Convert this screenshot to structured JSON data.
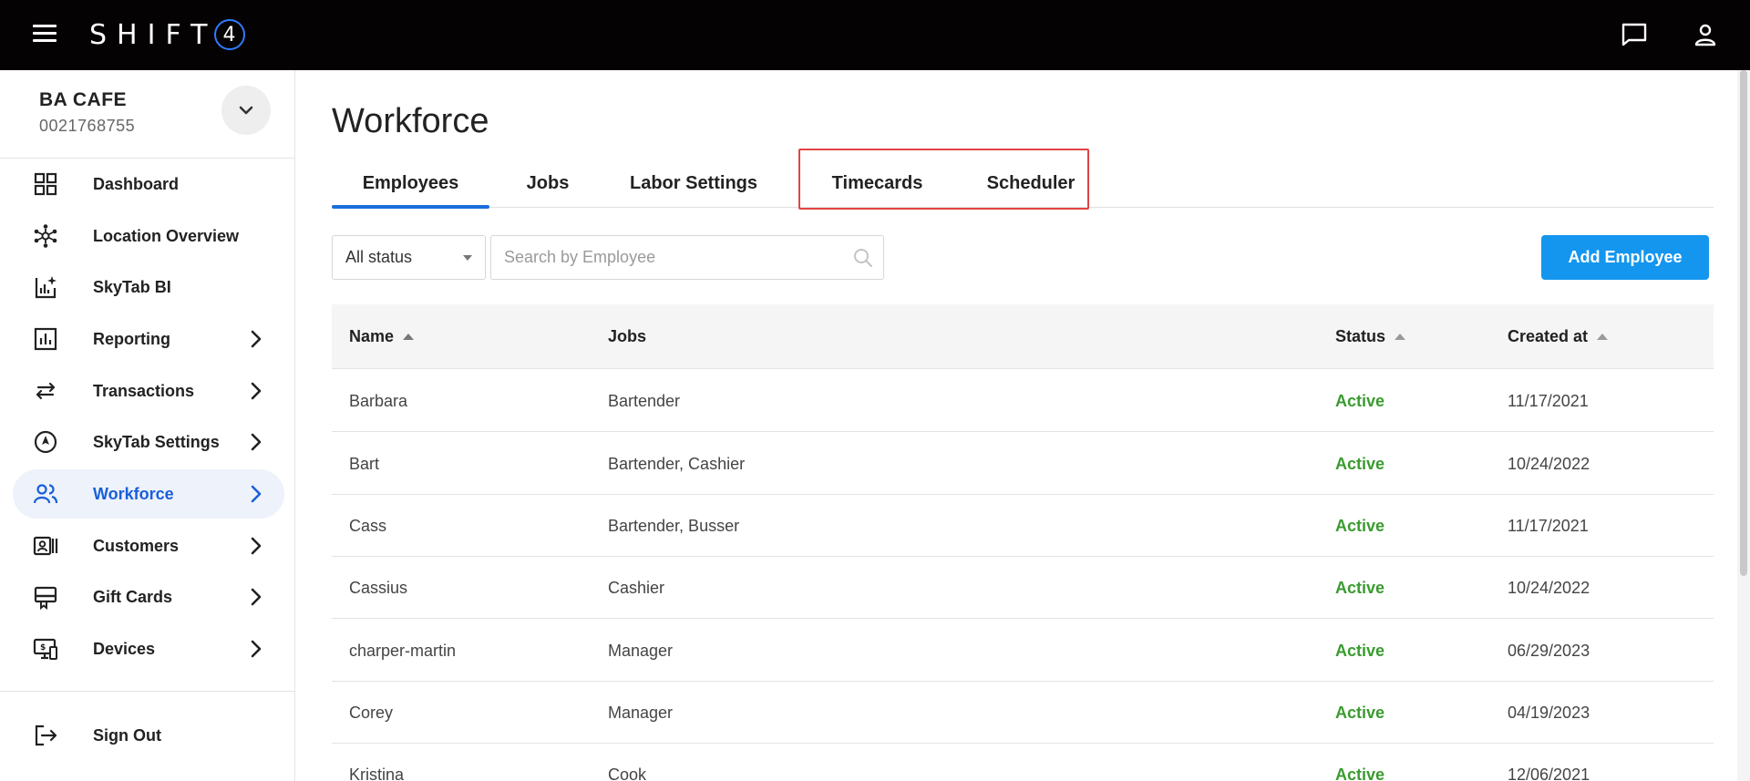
{
  "header": {
    "logo_text": "SHIFT",
    "logo_number": "4",
    "menu_icon": "hamburger-menu-icon",
    "chat_icon": "chat-bubble-icon",
    "user_icon": "user-account-icon"
  },
  "location": {
    "name": "BA CAFE",
    "id": "0021768755"
  },
  "sidebar": {
    "items": [
      {
        "label": "Dashboard",
        "icon": "dashboard-grid-icon",
        "has_chevron": false,
        "active": false
      },
      {
        "label": "Location Overview",
        "icon": "network-hub-icon",
        "has_chevron": false,
        "active": false
      },
      {
        "label": "SkyTab BI",
        "icon": "bi-chart-sparkle-icon",
        "has_chevron": false,
        "active": false
      },
      {
        "label": "Reporting",
        "icon": "bar-chart-icon",
        "has_chevron": true,
        "active": false
      },
      {
        "label": "Transactions",
        "icon": "swap-arrows-icon",
        "has_chevron": true,
        "active": false
      },
      {
        "label": "SkyTab Settings",
        "icon": "compass-settings-icon",
        "has_chevron": true,
        "active": false
      },
      {
        "label": "Workforce",
        "icon": "people-icon",
        "has_chevron": true,
        "active": true
      },
      {
        "label": "Customers",
        "icon": "customer-card-icon",
        "has_chevron": true,
        "active": false
      },
      {
        "label": "Gift Cards",
        "icon": "gift-card-icon",
        "has_chevron": true,
        "active": false
      },
      {
        "label": "Devices",
        "icon": "devices-icon",
        "has_chevron": true,
        "active": false
      }
    ],
    "sign_out": "Sign Out"
  },
  "main": {
    "title": "Workforce",
    "tabs": [
      {
        "label": "Employees",
        "active": true
      },
      {
        "label": "Jobs",
        "active": false
      },
      {
        "label": "Labor Settings",
        "active": false
      },
      {
        "label": "Timecards",
        "active": false
      },
      {
        "label": "Scheduler",
        "active": false
      }
    ],
    "filter": {
      "selected": "All status"
    },
    "search": {
      "placeholder": "Search by Employee",
      "value": ""
    },
    "add_button": "Add Employee",
    "table": {
      "columns": [
        "Name",
        "Jobs",
        "Status",
        "Created at"
      ],
      "rows": [
        {
          "name": "Barbara",
          "jobs": "Bartender",
          "status": "Active",
          "created": "11/17/2021"
        },
        {
          "name": "Bart",
          "jobs": "Bartender, Cashier",
          "status": "Active",
          "created": "10/24/2022"
        },
        {
          "name": "Cass",
          "jobs": "Bartender, Busser",
          "status": "Active",
          "created": "11/17/2021"
        },
        {
          "name": "Cassius",
          "jobs": "Cashier",
          "status": "Active",
          "created": "10/24/2022"
        },
        {
          "name": "charper-martin",
          "jobs": "Manager",
          "status": "Active",
          "created": "06/29/2023"
        },
        {
          "name": "Corey",
          "jobs": "Manager",
          "status": "Active",
          "created": "04/19/2023"
        },
        {
          "name": "Kristina",
          "jobs": "Cook",
          "status": "Active",
          "created": "12/06/2021"
        }
      ]
    }
  },
  "colors": {
    "topbar": "#050203",
    "accent_blue": "#1a5fd8",
    "button_blue": "#1496ee",
    "status_green": "#3a9b2f",
    "highlight_red": "#e04444"
  }
}
